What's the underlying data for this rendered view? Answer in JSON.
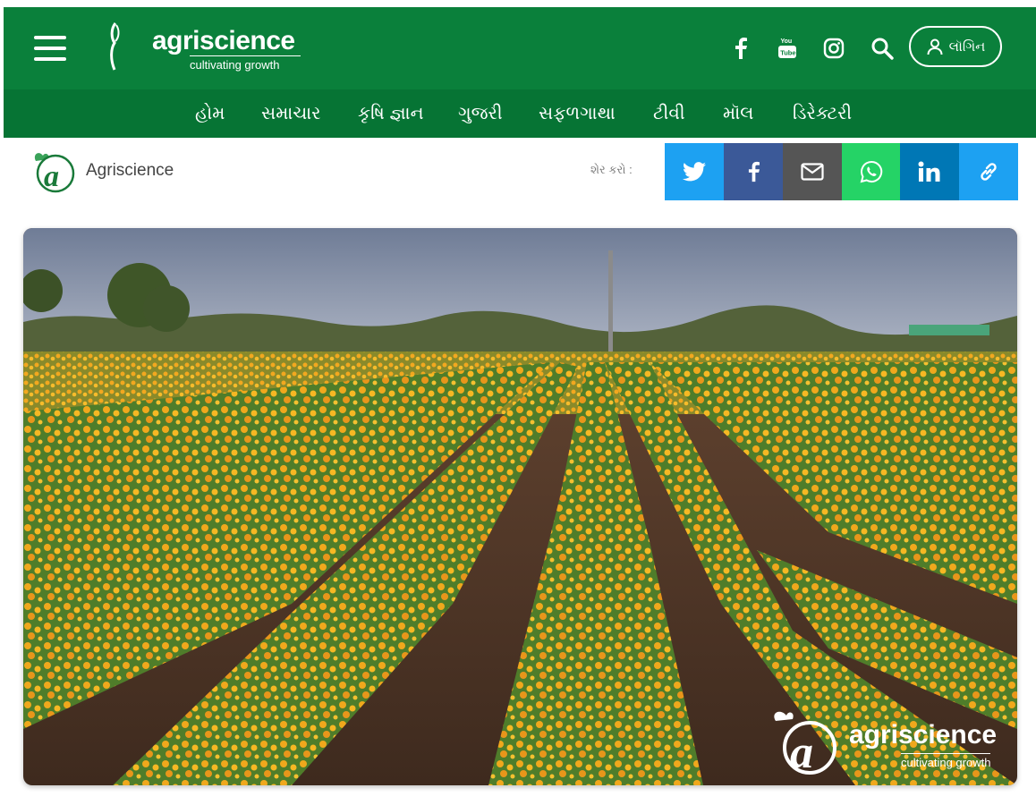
{
  "header": {
    "logo_name": "agriscience",
    "logo_tagline": "cultivating growth",
    "login_label": "લૉગિન",
    "icons": [
      "menu-icon",
      "facebook-icon",
      "youtube-icon",
      "instagram-icon",
      "search-icon",
      "user-icon"
    ]
  },
  "nav": {
    "items": [
      {
        "label": "હોમ"
      },
      {
        "label": "સમાચાર"
      },
      {
        "label": "કૃષિ જ્ઞાન"
      },
      {
        "label": "ગુજરી"
      },
      {
        "label": "સફળગાથા"
      },
      {
        "label": "ટીવી"
      },
      {
        "label": "મૉલ"
      },
      {
        "label": "ડિરેક્ટરી"
      }
    ]
  },
  "article": {
    "author": "Agriscience",
    "share_label": "શેર કરો :",
    "share_buttons": [
      {
        "name": "twitter-icon",
        "color": "#1da1f2"
      },
      {
        "name": "facebook-icon",
        "color": "#3b5998"
      },
      {
        "name": "mail-icon",
        "color": "#555555"
      },
      {
        "name": "whatsapp-icon",
        "color": "#25d366"
      },
      {
        "name": "linkedin-icon",
        "color": "#0077b5"
      },
      {
        "name": "link-icon",
        "color": "#1da1f2"
      }
    ],
    "image_watermark_name": "agriscience",
    "image_watermark_tagline": "cultivating growth"
  },
  "colors": {
    "header_green": "#0a803b",
    "nav_green": "#067434"
  }
}
